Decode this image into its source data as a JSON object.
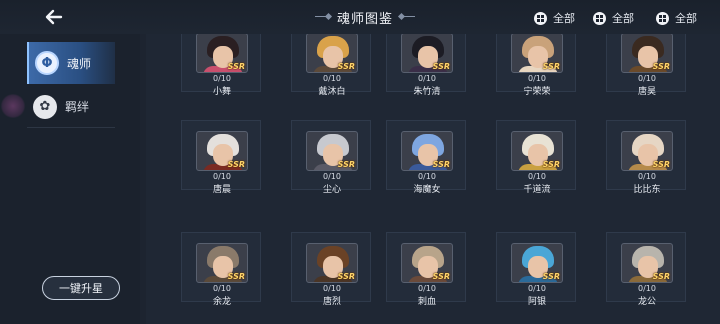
{
  "header": {
    "title": "魂师图鉴",
    "filters": [
      {
        "label": "全部"
      },
      {
        "label": "全部"
      },
      {
        "label": "全部"
      }
    ]
  },
  "sidebar": {
    "tabs": [
      {
        "label": "魂师",
        "icon": "soul-master-icon",
        "active": true
      },
      {
        "label": "羁绊",
        "icon": "bond-icon",
        "active": false
      }
    ],
    "upgrade_button": "一键升星"
  },
  "cards": [
    {
      "name": "小舞",
      "count": "0/10",
      "rarity": "SSR",
      "hair": "#2a1f22",
      "body": "#c94f6d"
    },
    {
      "name": "戴沐白",
      "count": "0/10",
      "rarity": "SSR",
      "hair": "#d9a24a",
      "body": "#5c4a3a"
    },
    {
      "name": "朱竹清",
      "count": "0/10",
      "rarity": "SSR",
      "hair": "#1c1c24",
      "body": "#3a2e48"
    },
    {
      "name": "宁荣荣",
      "count": "0/10",
      "rarity": "SSR",
      "hair": "#c9a27a",
      "body": "#e8d6c0"
    },
    {
      "name": "唐昊",
      "count": "0/10",
      "rarity": "SSR",
      "hair": "#3a2a20",
      "body": "#6a4a2a"
    },
    {
      "name": "唐晨",
      "count": "0/10",
      "rarity": "SSR",
      "hair": "#e4e0dc",
      "body": "#7a2a22"
    },
    {
      "name": "尘心",
      "count": "0/10",
      "rarity": "SSR",
      "hair": "#c7c9cf",
      "body": "#5a5a66"
    },
    {
      "name": "海魔女",
      "count": "0/10",
      "rarity": "SSR",
      "hair": "#7ea6e0",
      "body": "#3a5a9a"
    },
    {
      "name": "千道流",
      "count": "0/10",
      "rarity": "SSR",
      "hair": "#e8e2d4",
      "body": "#c9a040"
    },
    {
      "name": "比比东",
      "count": "0/10",
      "rarity": "SSR",
      "hair": "#e6d6c4",
      "body": "#b58a4a"
    },
    {
      "name": "余龙",
      "count": "0/10",
      "rarity": "SSR",
      "hair": "#8a7a6a",
      "body": "#5a4a3a"
    },
    {
      "name": "唐烈",
      "count": "0/10",
      "rarity": "SSR",
      "hair": "#6a4226",
      "body": "#4a3526"
    },
    {
      "name": "刺血",
      "count": "0/10",
      "rarity": "SSR",
      "hair": "#b8a48a",
      "body": "#6a4a3a"
    },
    {
      "name": "阿银",
      "count": "0/10",
      "rarity": "SSR",
      "hair": "#4aa6d6",
      "body": "#2a6a9a"
    },
    {
      "name": "龙公",
      "count": "0/10",
      "rarity": "SSR",
      "hair": "#b8b4ac",
      "body": "#8a6a3a"
    }
  ]
}
